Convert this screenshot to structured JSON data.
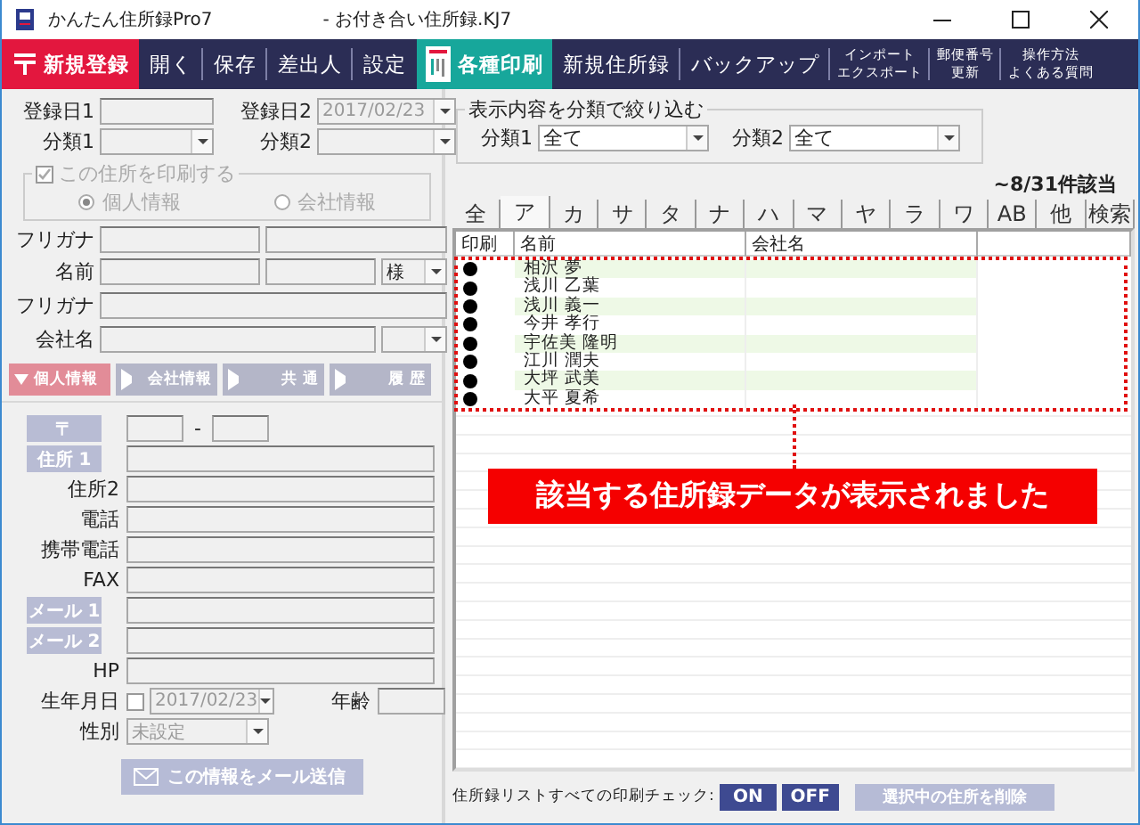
{
  "window": {
    "title": "かんたん住所録Pro7",
    "document": "- お付き合い住所録.KJ7"
  },
  "toolbar": [
    {
      "kind": "primary",
      "label": "新規登録"
    },
    {
      "kind": "normal",
      "label": "開く"
    },
    {
      "kind": "normal",
      "label": "保存"
    },
    {
      "kind": "normal",
      "label": "差出人"
    },
    {
      "kind": "normal",
      "label": "設定"
    },
    {
      "kind": "accent",
      "label": "各種印刷"
    },
    {
      "kind": "normal",
      "label": "新規住所録"
    },
    {
      "kind": "normal",
      "label": "バックアップ"
    },
    {
      "kind": "small",
      "lines": [
        "インポート",
        "エクスポート"
      ]
    },
    {
      "kind": "small",
      "lines": [
        "郵便番号",
        "更新"
      ]
    },
    {
      "kind": "small",
      "lines": [
        "操作方法",
        "よくある質問"
      ]
    }
  ],
  "record": {
    "date1_label": "登録日1",
    "date2_label": "登録日2",
    "date2_value": "2017/02/23",
    "category1_label": "分類1",
    "category2_label": "分類2"
  },
  "print_group": {
    "label": "この住所を印刷する",
    "checked": true,
    "disabled": true,
    "options": [
      {
        "label": "個人情報",
        "selected": true
      },
      {
        "label": "会社情報",
        "selected": false
      }
    ]
  },
  "name_fields": {
    "furigana_label": "フリガナ",
    "name_label": "名前",
    "honorific": "様",
    "furigana2_label": "フリガナ",
    "company_label": "会社名"
  },
  "section_tabs": [
    {
      "label": "個人情報",
      "selected": true
    },
    {
      "label": "会社情報",
      "selected": false
    },
    {
      "label": "共 通",
      "selected": false
    },
    {
      "label": "履 歴",
      "selected": false
    }
  ],
  "postal": {
    "label": "〒",
    "separator": "-"
  },
  "personal_fields": [
    {
      "kind": "button",
      "label": "住所 1"
    },
    {
      "kind": "text",
      "label": "住所2"
    },
    {
      "kind": "text",
      "label": "電話"
    },
    {
      "kind": "text",
      "label": "携帯電話"
    },
    {
      "kind": "text",
      "label": "FAX"
    },
    {
      "kind": "button",
      "label": "メール 1"
    },
    {
      "kind": "button",
      "label": "メール 2"
    },
    {
      "kind": "text",
      "label": "HP"
    }
  ],
  "birthday": {
    "label": "生年月日",
    "checked": false,
    "value": "2017/02/23",
    "age_label": "年齢"
  },
  "gender": {
    "label": "性別",
    "value": "未設定"
  },
  "mail_button": {
    "label": "この情報をメール送信",
    "disabled": true
  },
  "filter": {
    "legend": "表示内容を分類で絞り込む",
    "category1_label": "分類1",
    "category1_value": "全て",
    "category2_label": "分類2",
    "category2_value": "全て"
  },
  "match_count": "~8/31件該当",
  "kana_tabs": [
    {
      "label": "全",
      "selected": false
    },
    {
      "label": "ア",
      "selected": true
    },
    {
      "label": "カ",
      "selected": false
    },
    {
      "label": "サ",
      "selected": false
    },
    {
      "label": "タ",
      "selected": false
    },
    {
      "label": "ナ",
      "selected": false
    },
    {
      "label": "ハ",
      "selected": false
    },
    {
      "label": "マ",
      "selected": false
    },
    {
      "label": "ヤ",
      "selected": false
    },
    {
      "label": "ラ",
      "selected": false
    },
    {
      "label": "ワ",
      "selected": false
    },
    {
      "label": "AB",
      "selected": false
    },
    {
      "label": "他",
      "selected": false
    },
    {
      "label": "検索",
      "selected": false
    }
  ],
  "table": {
    "columns": [
      "印刷",
      "名前",
      "会社名"
    ],
    "rows": [
      {
        "print": true,
        "name": "相沢 夢"
      },
      {
        "print": true,
        "name": "浅川 乙葉"
      },
      {
        "print": true,
        "name": "浅川 義一"
      },
      {
        "print": true,
        "name": "今井 孝行"
      },
      {
        "print": true,
        "name": "宇佐美 隆明"
      },
      {
        "print": true,
        "name": "江川 潤夫"
      },
      {
        "print": true,
        "name": "大坪 武美"
      },
      {
        "print": true,
        "name": "大平 夏希"
      }
    ]
  },
  "callout": "該当する住所録データが表示されました",
  "bulk_print": {
    "label": "住所録リストすべての印刷チェック:",
    "on": "ON",
    "off": "OFF"
  },
  "delete_button": {
    "label": "選択中の住所を削除",
    "disabled": true
  }
}
